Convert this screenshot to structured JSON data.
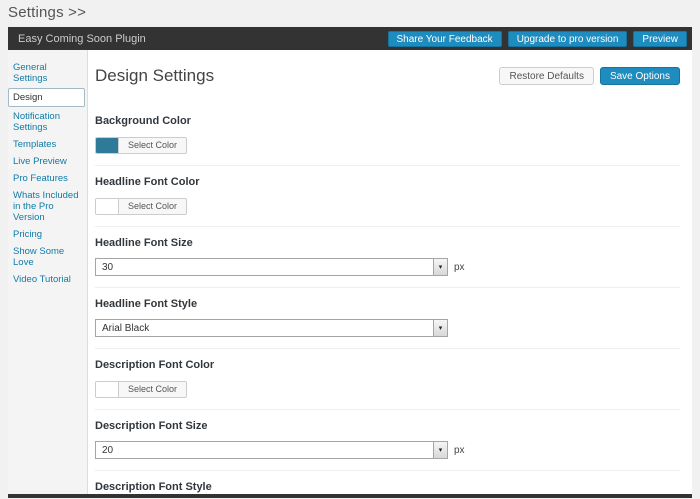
{
  "page": {
    "title": "Settings >>"
  },
  "icons": {
    "select_caret": "▾"
  },
  "plugin_bar": {
    "title": "Easy Coming Soon Plugin",
    "buttons": [
      {
        "label": "Share Your Feedback"
      },
      {
        "label": "Upgrade to pro version"
      },
      {
        "label": "Preview"
      }
    ]
  },
  "sidebar": {
    "items": [
      {
        "label": "General Settings"
      },
      {
        "label": "Design",
        "active": true
      },
      {
        "label": "Notification Settings"
      },
      {
        "label": "Templates"
      },
      {
        "label": "Live Preview"
      },
      {
        "label": "Pro Features"
      },
      {
        "label": "Whats Included in the Pro Version"
      },
      {
        "label": "Pricing"
      },
      {
        "label": "Show Some Love"
      },
      {
        "label": "Video Tutorial"
      }
    ]
  },
  "main": {
    "title": "Design Settings",
    "restore_label": "Restore Defaults",
    "save_label": "Save Options",
    "sections": [
      {
        "label": "Background Color",
        "type": "color",
        "picker_label": "Select Color",
        "swatch_style": "background:#2d7a99"
      },
      {
        "label": "Headline Font Color",
        "type": "color",
        "picker_label": "Select Color",
        "swatch_style": "background:#ffffff"
      },
      {
        "label": "Headline Font Size",
        "type": "select",
        "value": "30",
        "suffix": "px"
      },
      {
        "label": "Headline Font Style",
        "type": "select",
        "value": "Arial Black"
      },
      {
        "label": "Description Font Color",
        "type": "color",
        "picker_label": "Select Color",
        "swatch_style": "background:#ffffff"
      },
      {
        "label": "Description Font Size",
        "type": "select",
        "value": "20",
        "suffix": "px"
      },
      {
        "label": "Description Font Style",
        "type": "label-only"
      }
    ]
  },
  "colors": {
    "accent_blue": "#1e8cbe",
    "bar_dark": "#333333",
    "background_swatch": "#2d7a99",
    "sidebar_link": "#0f7ba8"
  }
}
